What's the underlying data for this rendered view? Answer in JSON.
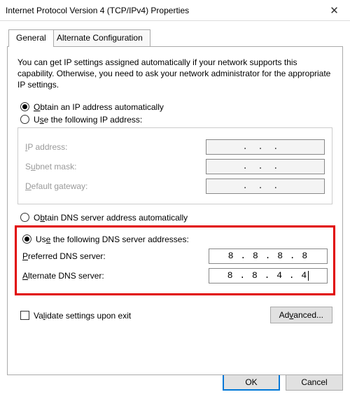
{
  "window": {
    "title": "Internet Protocol Version 4 (TCP/IPv4) Properties",
    "close_icon": "✕"
  },
  "tabs": {
    "general": "General",
    "alternate": "Alternate Configuration"
  },
  "description": "You can get IP settings assigned automatically if your network supports this capability. Otherwise, you need to ask your network administrator for the appropriate IP settings.",
  "ip": {
    "auto": {
      "accel": "O",
      "rest": "btain an IP address automatically"
    },
    "manual": {
      "accel_pre": "U",
      "accel": "s",
      "rest": "e the following IP address:"
    },
    "fields": {
      "address": {
        "accel": "I",
        "rest": "P address:"
      },
      "subnet": {
        "accel_pre": "S",
        "accel": "u",
        "rest": "bnet mask:"
      },
      "gateway": {
        "accel": "D",
        "rest": "efault gateway:"
      }
    }
  },
  "dns": {
    "auto": {
      "accel": "O",
      "accel2": "b",
      "rest": "tain DNS server address automatically"
    },
    "manual": {
      "accel_pre": "Us",
      "accel": "e",
      "rest": " the following DNS server addresses:"
    },
    "fields": {
      "preferred": {
        "accel": "P",
        "rest": "referred DNS server:",
        "value": "8 . 8 . 8 . 8"
      },
      "alternate": {
        "accel": "A",
        "rest": "lternate DNS server:",
        "value": "8 . 8 . 4 . 4"
      }
    }
  },
  "validate": {
    "accel_pre": "Va",
    "accel": "l",
    "rest": "idate settings upon exit"
  },
  "buttons": {
    "advanced": {
      "accel_pre": "Ad",
      "accel": "v",
      "rest": "anced..."
    },
    "ok": "OK",
    "cancel": "Cancel"
  }
}
